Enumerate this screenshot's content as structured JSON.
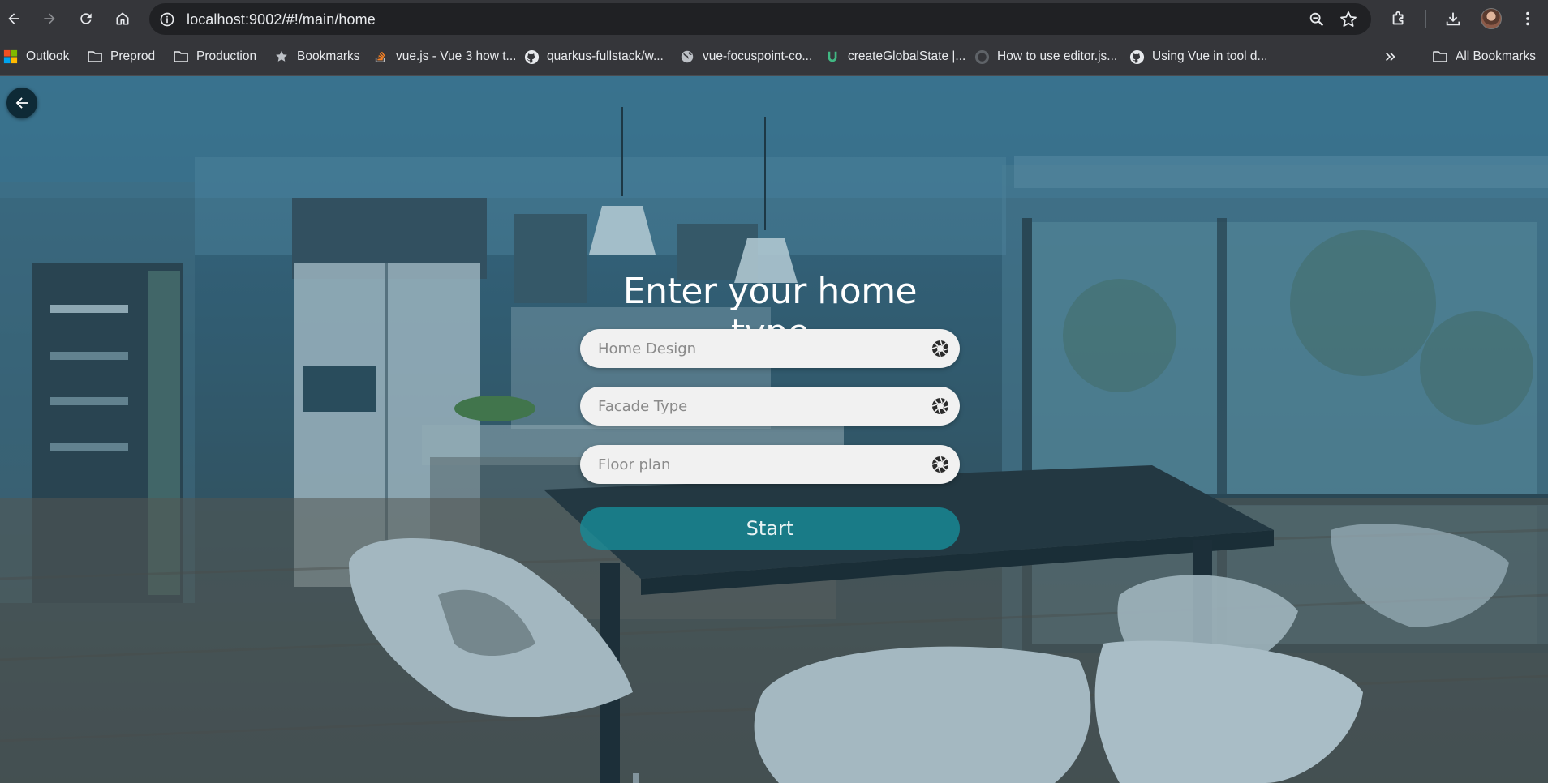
{
  "browser": {
    "url": "localhost:9002/#!/main/home",
    "bookmarks": [
      {
        "label": "Outlook",
        "icon": "outlook-icon"
      },
      {
        "label": "Preprod",
        "icon": "folder-icon"
      },
      {
        "label": "Production",
        "icon": "folder-icon"
      },
      {
        "label": "Bookmarks",
        "icon": "star-icon"
      },
      {
        "label": "vue.js - Vue 3 how t...",
        "icon": "stackoverflow-icon"
      },
      {
        "label": "quarkus-fullstack/w...",
        "icon": "github-icon"
      },
      {
        "label": "vue-focuspoint-co...",
        "icon": "globe-icon"
      },
      {
        "label": "createGlobalState |...",
        "icon": "vueuse-icon"
      },
      {
        "label": "How to use editor.js...",
        "icon": "github-icon"
      },
      {
        "label": "Using Vue in tool d...",
        "icon": "github-icon"
      }
    ],
    "all_bookmarks_label": "All Bookmarks"
  },
  "page": {
    "title": "Enter your home type",
    "fields": [
      {
        "placeholder": "Home Design",
        "icon": "camera-aperture-icon"
      },
      {
        "placeholder": "Facade Type",
        "icon": "camera-aperture-icon"
      },
      {
        "placeholder": "Floor plan",
        "icon": "camera-aperture-icon"
      }
    ],
    "start_label": "Start",
    "back_icon": "arrow-left-icon"
  },
  "colors": {
    "start_button": "#178a96",
    "back_button": "#0e2a36",
    "overlay": "#1e5f7d"
  }
}
